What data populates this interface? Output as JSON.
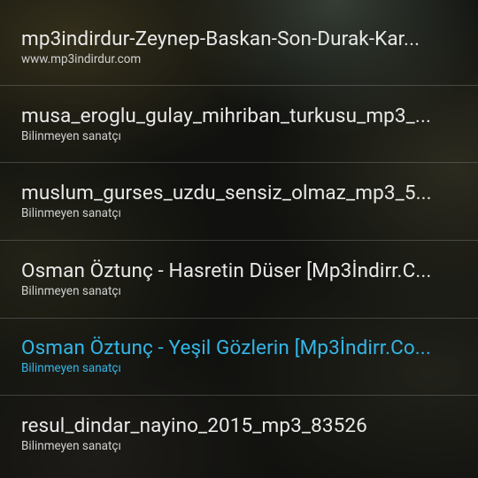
{
  "colors": {
    "text_primary": "#e8e8e8",
    "text_secondary": "#d0d0d0",
    "accent_active": "#33b5e5",
    "divider": "#5a5a5a"
  },
  "tracks": [
    {
      "title": "mp3indirdur-Zeynep-Baskan-Son-Durak-Kar...",
      "subtitle": "www.mp3indirdur.com",
      "active": false
    },
    {
      "title": "musa_eroglu_gulay_mihriban_turkusu_mp3_...",
      "subtitle": "Bilinmeyen sanatçı",
      "active": false
    },
    {
      "title": "muslum_gurses_uzdu_sensiz_olmaz_mp3_5...",
      "subtitle": "Bilinmeyen sanatçı",
      "active": false
    },
    {
      "title": "Osman Öztunç - Hasretin Düser [Mp3İndirr.C...",
      "subtitle": "Bilinmeyen sanatçı",
      "active": false
    },
    {
      "title": "Osman Öztunç - Yeşil Gözlerin [Mp3İndirr.Co...",
      "subtitle": "Bilinmeyen sanatçı",
      "active": true
    },
    {
      "title": "resul_dindar_nayino_2015_mp3_83526",
      "subtitle": "Bilinmeyen sanatçı",
      "active": false
    }
  ]
}
